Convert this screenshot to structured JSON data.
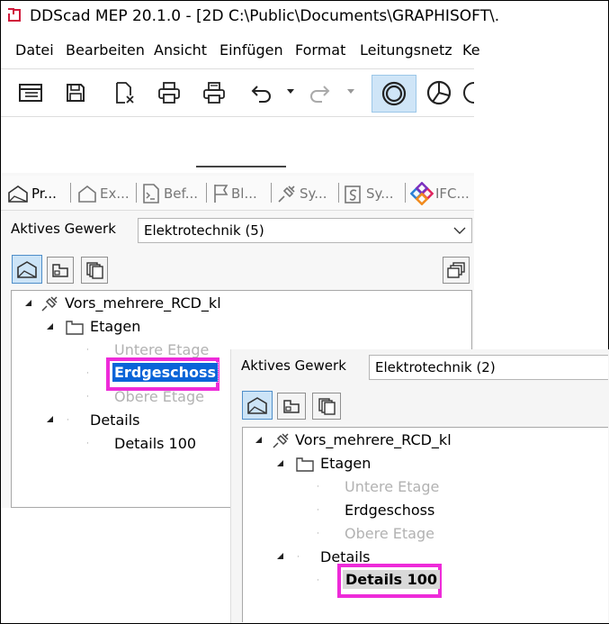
{
  "window": {
    "title": "DDScad MEP 20.1.0 - [2D  C:\\Public\\Documents\\GRAPHISOFT\\."
  },
  "menu": [
    {
      "label": "Datei"
    },
    {
      "label": "Bearbeiten"
    },
    {
      "label": "Ansicht"
    },
    {
      "label": "Einfügen"
    },
    {
      "label": "Format"
    },
    {
      "label": "Leitungsnetz"
    },
    {
      "label": "Ke"
    }
  ],
  "toolbar": {
    "buttons": [
      "properties-icon",
      "save-icon",
      "close-document-icon",
      "print-icon",
      "print-preview-icon",
      "undo-icon",
      "redo-icon",
      "circle-icon",
      "pie-chart-icon"
    ]
  },
  "tabs": [
    {
      "label": "Pr..."
    },
    {
      "label": "Ex..."
    },
    {
      "label": "Bef..."
    },
    {
      "label": "Bl..."
    },
    {
      "label": "Sy..."
    },
    {
      "label": "Sy..."
    },
    {
      "label": "IFC..."
    }
  ],
  "panel1": {
    "gewerk_label": "Aktives Gewerk",
    "gewerk_value": "Elektrotechnik (5)",
    "tree": {
      "root": "Vors_mehrere_RCD_kl",
      "etagen": "Etagen",
      "untere": "Untere Etage",
      "erdgeschoss": "Erdgeschoss",
      "obere": "Obere Etage",
      "details": "Details",
      "details100": "Details 100"
    }
  },
  "panel2": {
    "gewerk_label": "Aktives Gewerk",
    "gewerk_value": "Elektrotechnik (2)",
    "tree": {
      "root": "Vors_mehrere_RCD_kl",
      "etagen": "Etagen",
      "untere": "Untere Etage",
      "erdgeschoss": "Erdgeschoss",
      "obere": "Obere Etage",
      "details": "Details",
      "details100": "Details 100"
    }
  },
  "colors": {
    "highlight_border": "#ee2bd9",
    "selection": "#0a64d8",
    "muted_text": "#b2b2b2"
  }
}
